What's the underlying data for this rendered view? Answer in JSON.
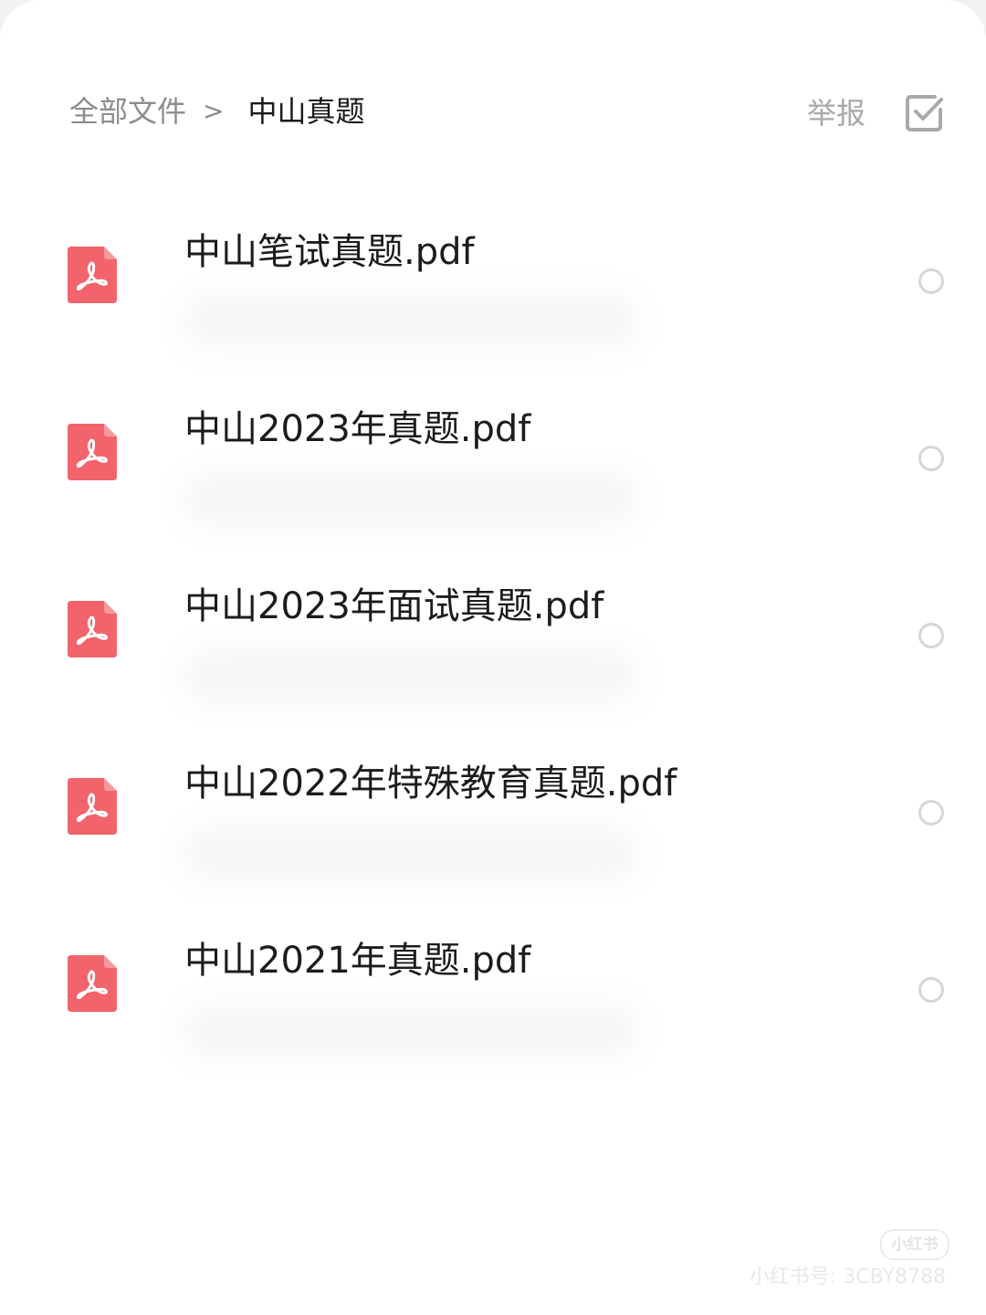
{
  "header": {
    "breadcrumb": {
      "root": "全部文件",
      "separator": ">",
      "current": "中山真题"
    },
    "report_label": "举报",
    "multi_select_icon": "checkbox-checked-icon"
  },
  "files": [
    {
      "name": "中山笔试真题.pdf",
      "icon": "pdf-icon",
      "selected": false
    },
    {
      "name": "中山2023年真题.pdf",
      "icon": "pdf-icon",
      "selected": false
    },
    {
      "name": "中山2023年面试真题.pdf",
      "icon": "pdf-icon",
      "selected": false
    },
    {
      "name": "中山2022年特殊教育真题.pdf",
      "icon": "pdf-icon",
      "selected": false
    },
    {
      "name": "中山2021年真题.pdf",
      "icon": "pdf-icon",
      "selected": false
    }
  ],
  "watermark": {
    "logo": "小红书",
    "id": "小红书号: 3CBY8788"
  },
  "colors": {
    "pdf_icon": "#f2636c",
    "text_primary": "#1c1c1c",
    "text_secondary": "#8c8c8c",
    "report": "#a8a8a8",
    "radio_border": "#d6d6d6"
  }
}
